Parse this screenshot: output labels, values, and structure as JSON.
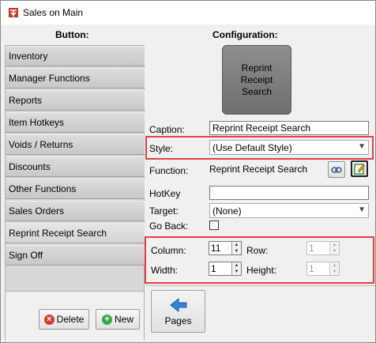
{
  "window": {
    "title": "Sales on Main"
  },
  "left": {
    "header": "Button:",
    "buttons": [
      {
        "label": "Inventory"
      },
      {
        "label": "Manager Functions"
      },
      {
        "label": "Reports"
      },
      {
        "label": "Item Hotkeys"
      },
      {
        "label": "Voids / Returns"
      },
      {
        "label": "Discounts"
      },
      {
        "label": "Other Functions"
      },
      {
        "label": "Sales Orders"
      },
      {
        "label": "Reprint Receipt Search"
      },
      {
        "label": "Sign Off"
      }
    ],
    "delete_label": "Delete",
    "new_label": "New"
  },
  "right": {
    "header": "Configuration:",
    "preview_label": "Reprint Receipt Search",
    "caption_label": "Caption:",
    "caption_value": "Reprint Receipt Search",
    "style_label": "Style:",
    "style_value": "(Use Default Style)",
    "function_label": "Function:",
    "function_value": "Reprint Receipt Search",
    "hotkey_label": "HotKey",
    "hotkey_value": "",
    "target_label": "Target:",
    "target_value": "(None)",
    "goback_label": "Go Back:",
    "column_label": "Column:",
    "column_value": "11",
    "row_label": "Row:",
    "row_value": "1",
    "width_label": "Width:",
    "width_value": "1",
    "height_label": "Height:",
    "height_value": "1",
    "pages_label": "Pages"
  },
  "colors": {
    "highlight_border": "#e04040",
    "delete_icon": "#d83a2e",
    "new_icon": "#3aa845",
    "pages_arrow": "#2f86d6"
  },
  "icons": [
    "app-logo-icon",
    "delete-icon",
    "new-icon",
    "link-icon",
    "edit-icon",
    "pages-arrow-icon"
  ]
}
